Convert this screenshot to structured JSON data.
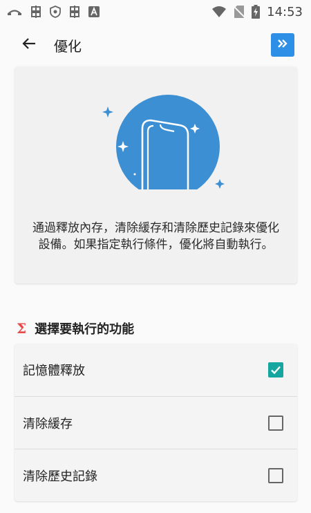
{
  "status_bar": {
    "time": "14:53",
    "left_icons": [
      "call-icon",
      "bug-icon",
      "shield-icon",
      "bug-icon",
      "a-icon"
    ],
    "right_icons": [
      "wifi-icon",
      "no-sim-icon",
      "battery-charging-icon"
    ]
  },
  "app_bar": {
    "title": "優化",
    "skip_icon": "double-chevron-right-icon"
  },
  "info_card": {
    "description": "通過釋放內存，清除緩存和清除歷史記錄來優化設備。如果指定執行條件，優化將自動執行。"
  },
  "section": {
    "icon": "sigma-icon",
    "title": "選擇要執行的功能"
  },
  "options": [
    {
      "label": "記憶體釋放",
      "checked": true
    },
    {
      "label": "清除緩存",
      "checked": false
    },
    {
      "label": "清除歷史記錄",
      "checked": false
    }
  ],
  "colors": {
    "accent": "#2e8fe6",
    "checkbox_checked": "#15a6a0",
    "sigma": "#e84a4a",
    "illustration": "#3d8fd4"
  }
}
